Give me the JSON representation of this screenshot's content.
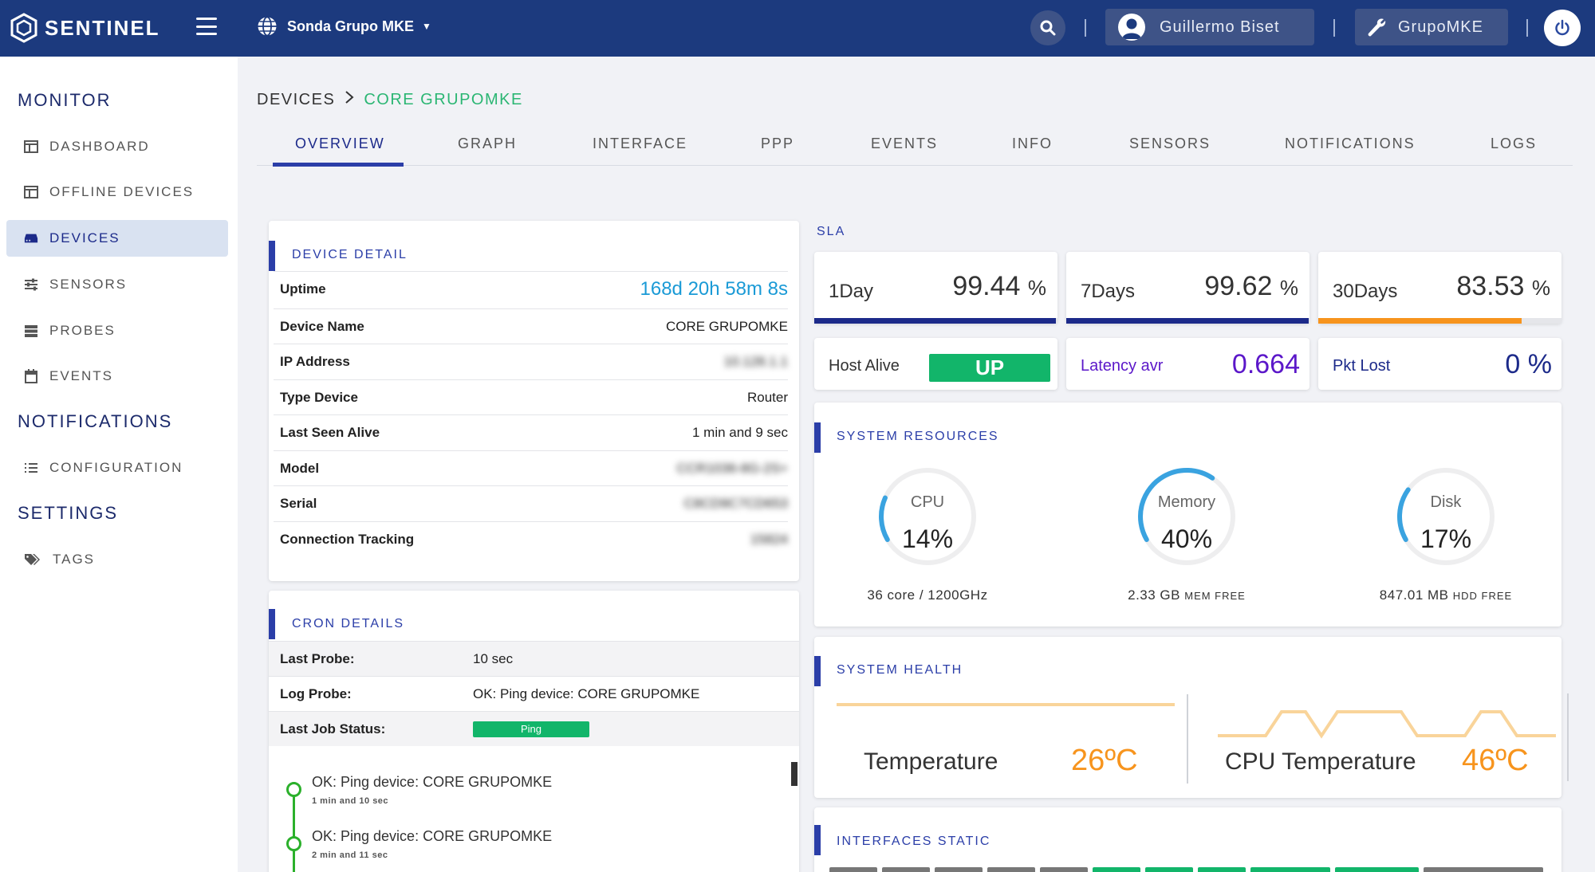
{
  "header": {
    "logo_text": "SENTINEL",
    "org_name": "Sonda Grupo MKE",
    "user_name": "Guillermo Biset",
    "group_name": "GrupoMKE"
  },
  "sidebar": {
    "monitor_title": "MONITOR",
    "notifications_title": "NOTIFICATIONS",
    "settings_title": "SETTINGS",
    "items": {
      "dashboard": "DASHBOARD",
      "offline_devices": "OFFLINE DEVICES",
      "devices": "DEVICES",
      "sensors": "SENSORS",
      "probes": "PROBES",
      "events": "EVENTS",
      "configuration": "CONFIGURATION",
      "tags": "TAGS"
    }
  },
  "breadcrumb": {
    "root": "DEVICES",
    "current": "CORE GRUPOMKE"
  },
  "tabs": [
    "OVERVIEW",
    "GRAPH",
    "INTERFACE",
    "PPP",
    "EVENTS",
    "INFO",
    "SENSORS",
    "NOTIFICATIONS",
    "LOGS"
  ],
  "device_detail": {
    "title": "DEVICE DETAIL",
    "rows": [
      {
        "label": "Uptime",
        "value": "168d 20h 58m 8s"
      },
      {
        "label": "Device Name",
        "value": "CORE GRUPOMKE"
      },
      {
        "label": "IP Address",
        "value": "10.128.1.1"
      },
      {
        "label": "Type Device",
        "value": "Router"
      },
      {
        "label": "Last Seen Alive",
        "value": "1 min and 9 sec"
      },
      {
        "label": "Model",
        "value": "CCR1036-8G-2S+"
      },
      {
        "label": "Serial",
        "value": "C8CD9C7CD653"
      },
      {
        "label": "Connection Tracking",
        "value": "15824"
      }
    ]
  },
  "cron_details": {
    "title": "CRON DETAILS",
    "last_probe_label": "Last Probe:",
    "last_probe_value": "10 sec",
    "log_probe_label": "Log Probe:",
    "log_probe_value": "OK: Ping device: CORE GRUPOMKE",
    "last_job_label": "Last Job Status:",
    "last_job_value": "Ping",
    "timeline": [
      {
        "text": "OK: Ping device: CORE GRUPOMKE",
        "time": "1 min and 10 sec"
      },
      {
        "text": "OK: Ping device: CORE GRUPOMKE",
        "time": "2 min and 11 sec"
      }
    ]
  },
  "sla": {
    "title": "SLA",
    "cards": [
      {
        "label": "1Day",
        "value": "99.44",
        "unit": "%",
        "percent": 99.44,
        "color": "#1c2a8a"
      },
      {
        "label": "7Days",
        "value": "99.62",
        "unit": "%",
        "percent": 99.62,
        "color": "#1c2a8a"
      },
      {
        "label": "30Days",
        "value": "83.53",
        "unit": "%",
        "percent": 83.53,
        "color": "#f7941d"
      }
    ],
    "host_alive_label": "Host Alive",
    "host_alive_value": "UP",
    "latency_label": "Latency avr",
    "latency_value": "0.664",
    "pkt_lost_label": "Pkt Lost",
    "pkt_lost_value": "0 %"
  },
  "system_resources": {
    "title": "SYSTEM RESOURCES",
    "cpu": {
      "label": "CPU",
      "value": "14%",
      "percent": 14,
      "sub": "36 core / 1200GHz"
    },
    "memory": {
      "label": "Memory",
      "value": "40%",
      "percent": 40,
      "sub_value": "2.33 GB",
      "sub_unit": "MEM FREE"
    },
    "disk": {
      "label": "Disk",
      "value": "17%",
      "percent": 17,
      "sub_value": "847.01 MB",
      "sub_unit": "HDD FREE"
    }
  },
  "system_health": {
    "title": "SYSTEM HEALTH",
    "temperature_label": "Temperature",
    "temperature_value": "26ºC",
    "cpu_temperature_label": "CPU Temperature",
    "cpu_temperature_value": "46ºC"
  },
  "interfaces": {
    "title": "INTERFACES STATIC"
  },
  "colors": {
    "topbar": "#1c3a7e",
    "accent": "#2b3ea8",
    "green": "#12b56a",
    "orange": "#f7941d",
    "uptime": "#1a9ad6",
    "purple": "#5b17c9"
  }
}
